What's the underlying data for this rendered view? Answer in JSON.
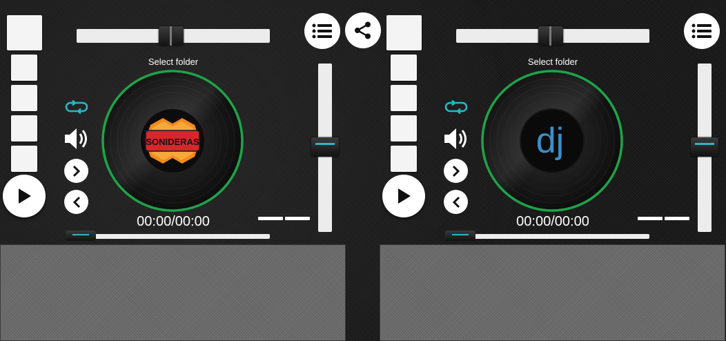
{
  "share": {
    "icon": "share-icon"
  },
  "decks": {
    "left": {
      "select_folder": "Select folder",
      "time": "00:00/00:00",
      "label_icon": "sonideras-logo",
      "crossfade_level": 0.49,
      "volume_level": 0.5,
      "progress": 0.0
    },
    "right": {
      "select_folder": "Select folder",
      "time": "00:00/00:00",
      "label_icon": "dj-logo",
      "crossfade_level": 0.49,
      "volume_level": 0.5,
      "progress": 0.0
    }
  },
  "colors": {
    "accent": "#2bb5c8",
    "ring": "#1fa34a",
    "background": "#161616",
    "pad": "#6b6b6b"
  }
}
